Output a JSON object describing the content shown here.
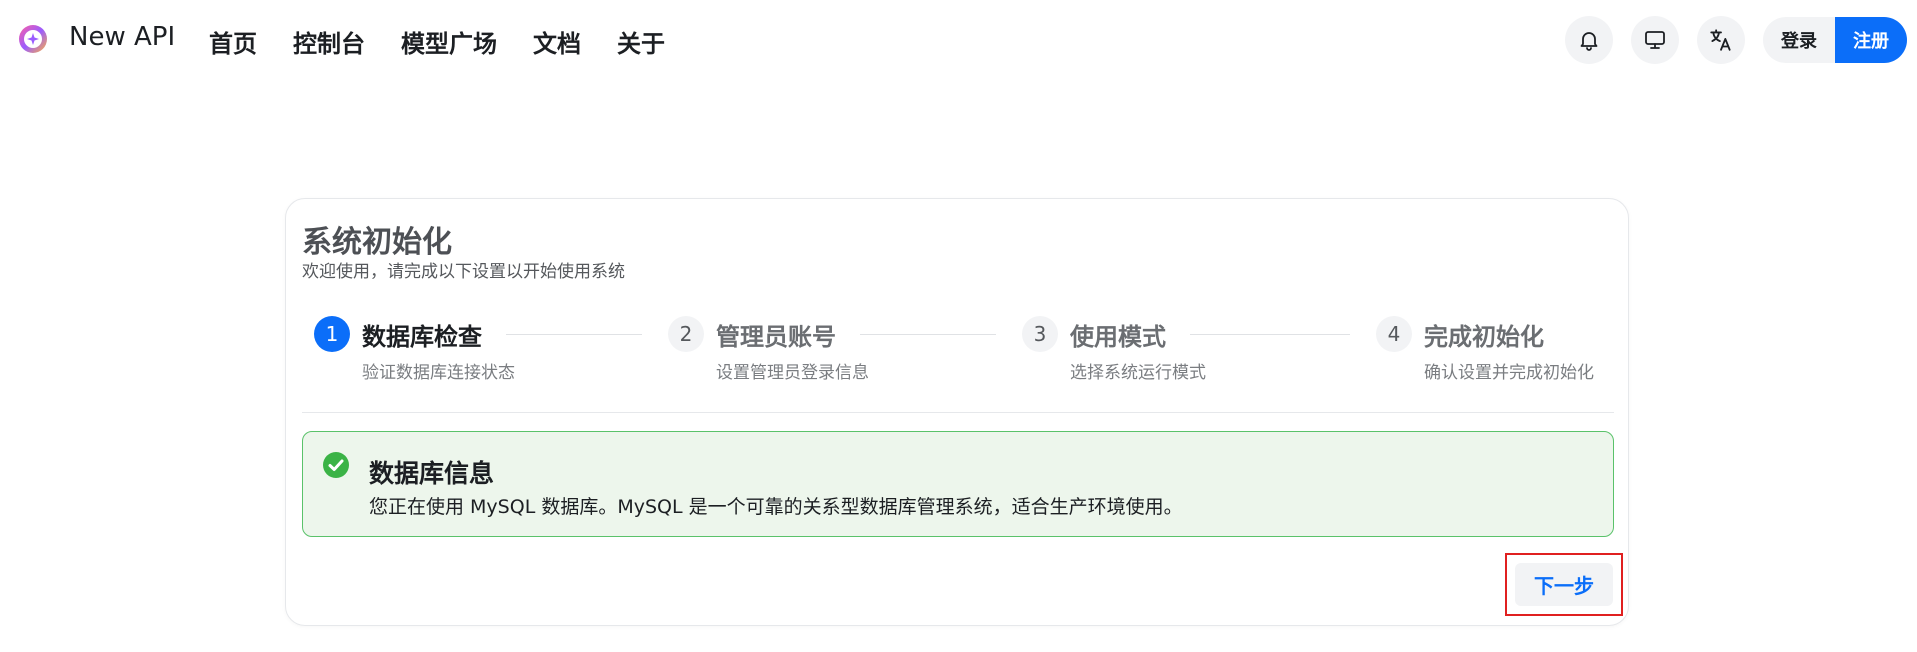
{
  "app": {
    "brand": "New API"
  },
  "nav": [
    "首页",
    "控制台",
    "模型广场",
    "文档",
    "关于"
  ],
  "header_icons": [
    "bell-icon",
    "monitor-icon",
    "translate-icon"
  ],
  "auth": {
    "login": "登录",
    "register": "注册"
  },
  "card": {
    "title": "系统初始化",
    "subtitle": "欢迎使用，请完成以下设置以开始使用系统",
    "steps": [
      {
        "number": "1",
        "title": "数据库检查",
        "desc": "验证数据库连接状态",
        "active": true
      },
      {
        "number": "2",
        "title": "管理员账号",
        "desc": "设置管理员登录信息",
        "active": false
      },
      {
        "number": "3",
        "title": "使用模式",
        "desc": "选择系统运行模式",
        "active": false
      },
      {
        "number": "4",
        "title": "完成初始化",
        "desc": "确认设置并完成初始化",
        "active": false
      }
    ],
    "info": {
      "title": "数据库信息",
      "text": "您正在使用 MySQL 数据库。MySQL 是一个可靠的关系型数据库管理系统，适合生产环境使用。"
    },
    "next_label": "下一步"
  },
  "colors": {
    "accent": "#0b6ef9",
    "success_bg": "#edf6ec",
    "success_border": "#5ac26a",
    "highlight": "#e02020"
  }
}
